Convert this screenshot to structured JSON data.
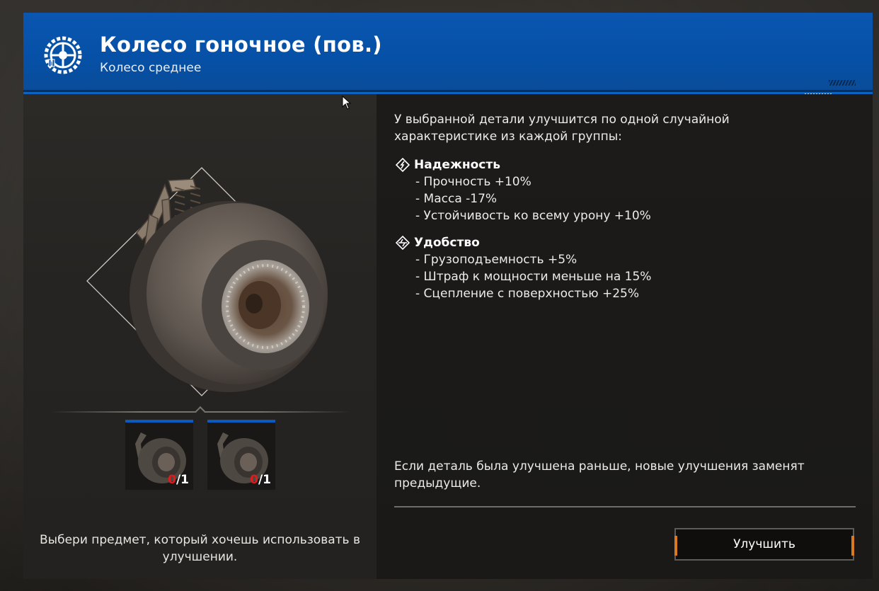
{
  "header": {
    "title": "Колесо гоночное (пов.)",
    "subtitle": "Колесо среднее",
    "icon": "wheel-upgrade-icon",
    "color": "#0650a6"
  },
  "left_panel": {
    "slots": [
      {
        "current": "0",
        "separator": "/",
        "required": "1"
      },
      {
        "current": "0",
        "separator": "/",
        "required": "1"
      }
    ],
    "hint": "Выбери предмет, который хочешь использовать в улучшении."
  },
  "right_panel": {
    "intro": "У выбранной детали улучшится по одной случайной характеристике из каждой группы:",
    "groups": [
      {
        "title": "Надежность",
        "icon": "reliability-diamond-icon",
        "items": [
          "- Прочность +10%",
          "- Масса -17%",
          "- Устойчивость ко всему урону +10%"
        ]
      },
      {
        "title": "Удобство",
        "icon": "convenience-diamond-icon",
        "items": [
          "- Грузоподъемность +5%",
          "- Штраф к мощности меньше на 15%",
          "- Сцепление с поверхностью +25%"
        ]
      }
    ],
    "note": "Если деталь была улучшена раньше, новые улучшения заменят предыдущие.",
    "upgrade_button": "Улучшить"
  },
  "colors": {
    "accent_blue": "#0a5bc0",
    "count_missing": "#e01b1b",
    "button_tab": "#d77a22"
  }
}
